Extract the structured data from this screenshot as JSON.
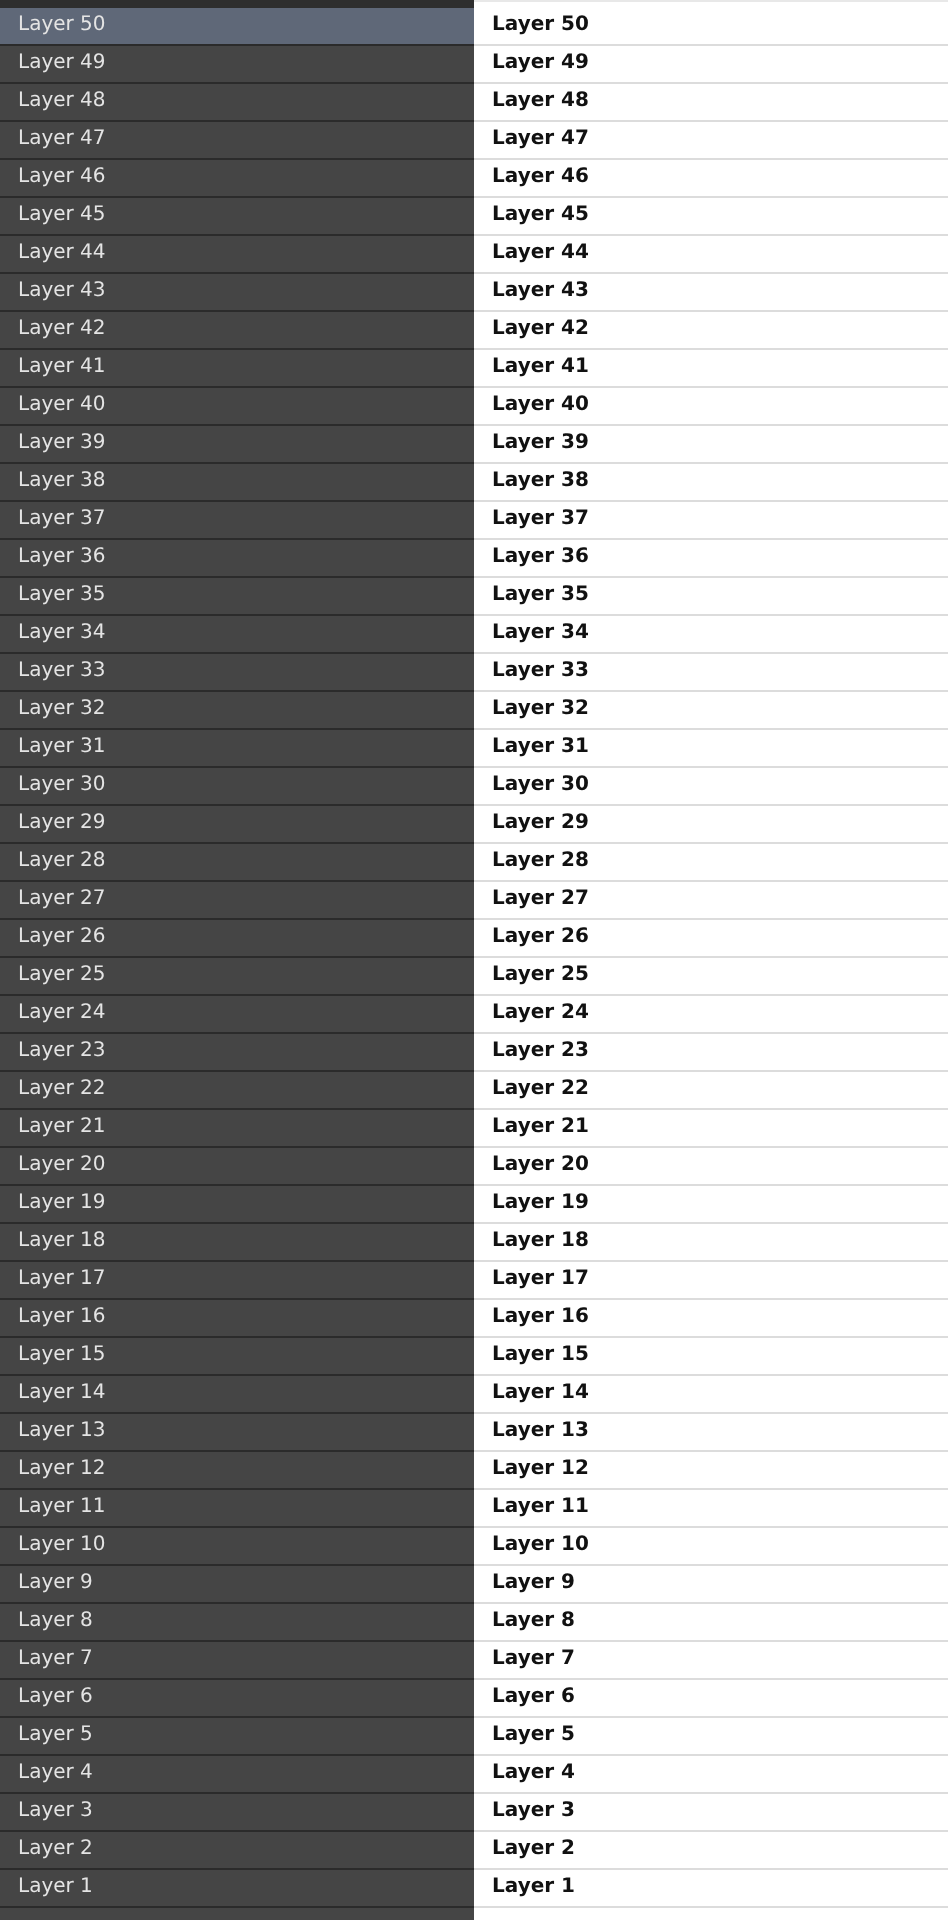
{
  "layers_panel": {
    "items": [
      {
        "label": "Layer 50",
        "selected": true
      },
      {
        "label": "Layer 49",
        "selected": false
      },
      {
        "label": "Layer 48",
        "selected": false
      },
      {
        "label": "Layer 47",
        "selected": false
      },
      {
        "label": "Layer 46",
        "selected": false
      },
      {
        "label": "Layer 45",
        "selected": false
      },
      {
        "label": "Layer 44",
        "selected": false
      },
      {
        "label": "Layer 43",
        "selected": false
      },
      {
        "label": "Layer 42",
        "selected": false
      },
      {
        "label": "Layer 41",
        "selected": false
      },
      {
        "label": "Layer 40",
        "selected": false
      },
      {
        "label": "Layer 39",
        "selected": false
      },
      {
        "label": "Layer 38",
        "selected": false
      },
      {
        "label": "Layer 37",
        "selected": false
      },
      {
        "label": "Layer 36",
        "selected": false
      },
      {
        "label": "Layer 35",
        "selected": false
      },
      {
        "label": "Layer 34",
        "selected": false
      },
      {
        "label": "Layer 33",
        "selected": false
      },
      {
        "label": "Layer 32",
        "selected": false
      },
      {
        "label": "Layer 31",
        "selected": false
      },
      {
        "label": "Layer 30",
        "selected": false
      },
      {
        "label": "Layer 29",
        "selected": false
      },
      {
        "label": "Layer 28",
        "selected": false
      },
      {
        "label": "Layer 27",
        "selected": false
      },
      {
        "label": "Layer 26",
        "selected": false
      },
      {
        "label": "Layer 25",
        "selected": false
      },
      {
        "label": "Layer 24",
        "selected": false
      },
      {
        "label": "Layer 23",
        "selected": false
      },
      {
        "label": "Layer 22",
        "selected": false
      },
      {
        "label": "Layer 21",
        "selected": false
      },
      {
        "label": "Layer 20",
        "selected": false
      },
      {
        "label": "Layer 19",
        "selected": false
      },
      {
        "label": "Layer 18",
        "selected": false
      },
      {
        "label": "Layer 17",
        "selected": false
      },
      {
        "label": "Layer 16",
        "selected": false
      },
      {
        "label": "Layer 15",
        "selected": false
      },
      {
        "label": "Layer 14",
        "selected": false
      },
      {
        "label": "Layer 13",
        "selected": false
      },
      {
        "label": "Layer 12",
        "selected": false
      },
      {
        "label": "Layer 11",
        "selected": false
      },
      {
        "label": "Layer 10",
        "selected": false
      },
      {
        "label": "Layer 9",
        "selected": false
      },
      {
        "label": "Layer 8",
        "selected": false
      },
      {
        "label": "Layer 7",
        "selected": false
      },
      {
        "label": "Layer 6",
        "selected": false
      },
      {
        "label": "Layer 5",
        "selected": false
      },
      {
        "label": "Layer 4",
        "selected": false
      },
      {
        "label": "Layer 3",
        "selected": false
      },
      {
        "label": "Layer 2",
        "selected": false
      },
      {
        "label": "Layer 1",
        "selected": false
      }
    ]
  },
  "name_list": {
    "items": [
      "Layer 50",
      "Layer 49",
      "Layer 48",
      "Layer 47",
      "Layer 46",
      "Layer 45",
      "Layer 44",
      "Layer 43",
      "Layer 42",
      "Layer 41",
      "Layer 40",
      "Layer 39",
      "Layer 38",
      "Layer 37",
      "Layer 36",
      "Layer 35",
      "Layer 34",
      "Layer 33",
      "Layer 32",
      "Layer 31",
      "Layer 30",
      "Layer 29",
      "Layer 28",
      "Layer 27",
      "Layer 26",
      "Layer 25",
      "Layer 24",
      "Layer 23",
      "Layer 22",
      "Layer 21",
      "Layer 20",
      "Layer 19",
      "Layer 18",
      "Layer 17",
      "Layer 16",
      "Layer 15",
      "Layer 14",
      "Layer 13",
      "Layer 12",
      "Layer 11",
      "Layer 10",
      "Layer 9",
      "Layer 8",
      "Layer 7",
      "Layer 6",
      "Layer 5",
      "Layer 4",
      "Layer 3",
      "Layer 2",
      "Layer 1"
    ]
  }
}
